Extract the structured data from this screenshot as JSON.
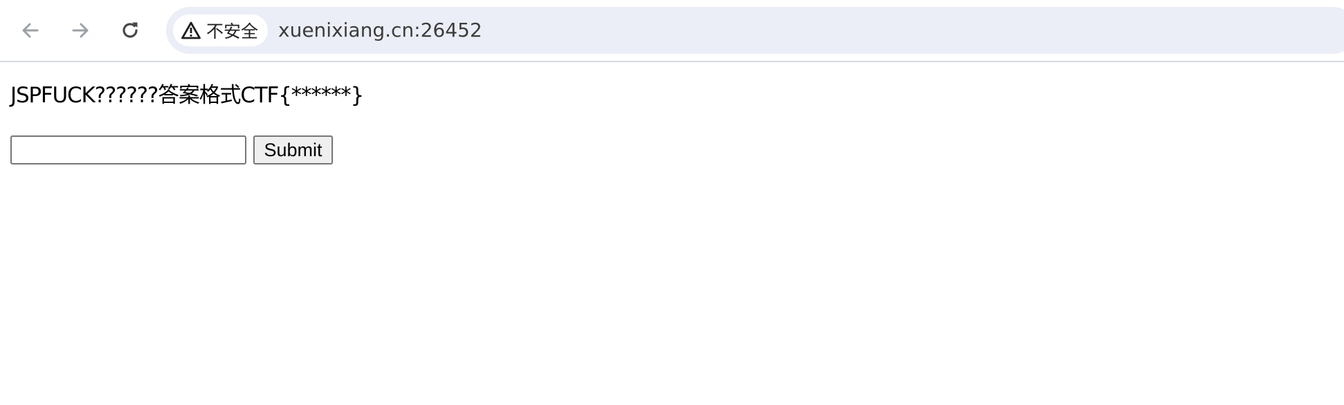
{
  "browser": {
    "security_label": "不安全",
    "url": "xuenixiang.cn:26452",
    "icons": {
      "back": "arrow-left-icon",
      "forward": "arrow-right-icon",
      "reload": "reload-icon",
      "security": "warning-triangle-icon"
    },
    "colors": {
      "omnibox_bg": "#ebeef6",
      "nav_disabled": "#9aa0a6",
      "nav_enabled": "#474747"
    }
  },
  "page": {
    "challenge_text": "JSPFUCK??????答案格式CTF{******}",
    "form": {
      "answer_value": "",
      "answer_placeholder": "",
      "submit_label": "Submit"
    }
  }
}
